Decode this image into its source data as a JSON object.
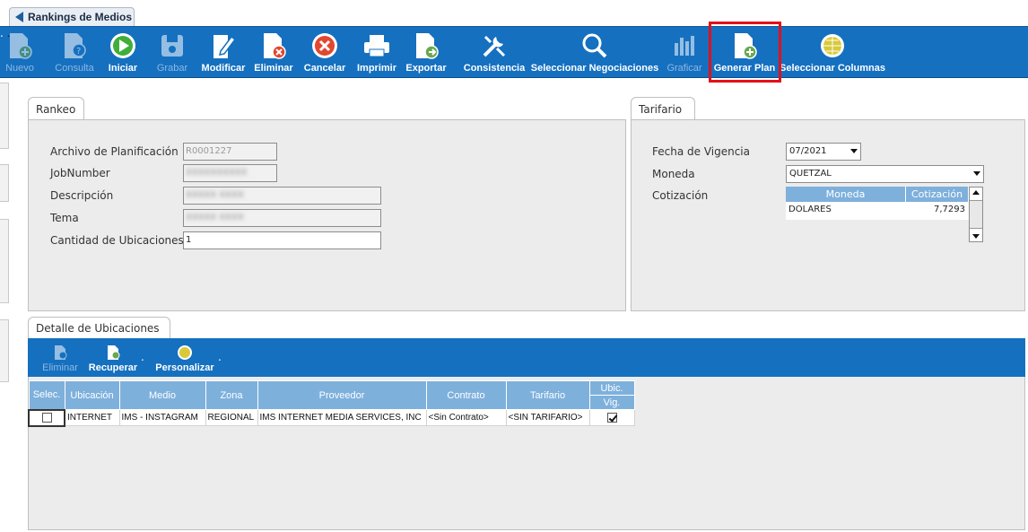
{
  "window": {
    "title": "Rankings de Medios"
  },
  "toolbar": {
    "items": [
      {
        "label": "Nuevo",
        "icon": "new-document-icon",
        "enabled": false
      },
      {
        "label": "Consulta",
        "icon": "query-document-icon",
        "enabled": false
      },
      {
        "label": "Iniciar",
        "icon": "play-icon",
        "enabled": true
      },
      {
        "label": "Grabar",
        "icon": "save-disk-icon",
        "enabled": false
      },
      {
        "label": "Modificar",
        "icon": "edit-document-icon",
        "enabled": true
      },
      {
        "label": "Eliminar",
        "icon": "delete-document-icon",
        "enabled": true
      },
      {
        "label": "Cancelar",
        "icon": "cancel-icon",
        "enabled": true
      },
      {
        "label": "Imprimir",
        "icon": "printer-icon",
        "enabled": true
      },
      {
        "label": "Exportar",
        "icon": "export-document-icon",
        "enabled": true
      },
      {
        "label": "Consistencia",
        "icon": "tools-icon",
        "enabled": true
      },
      {
        "label": "Seleccionar Negociaciones",
        "icon": "magnifier-icon",
        "enabled": true
      },
      {
        "label": "Graficar",
        "icon": "bar-chart-icon",
        "enabled": false
      },
      {
        "label": "Generar Plan",
        "icon": "generate-plan-document-icon",
        "enabled": true,
        "highlighted": true
      },
      {
        "label": "Seleccionar Columnas",
        "icon": "columns-globe-icon",
        "enabled": true
      }
    ]
  },
  "rankeo": {
    "tab_label": "Rankeo",
    "fields": {
      "archivo": {
        "label": "Archivo de Planificación",
        "value": "R0001227"
      },
      "jobnumber": {
        "label": "JobNumber",
        "value": "XXXXXXXXXX"
      },
      "descripcion": {
        "label": "Descripción",
        "value": "XXXXX XXXX"
      },
      "tema": {
        "label": "Tema",
        "value": "XXXXX XXXX"
      },
      "cantidad": {
        "label": "Cantidad de Ubicaciones",
        "value": "1"
      }
    }
  },
  "tarifario": {
    "tab_label": "Tarifario",
    "fecha_label": "Fecha de Vigencia",
    "fecha_value": "07/2021",
    "moneda_label": "Moneda",
    "moneda_value": "QUETZAL",
    "cotizacion_label": "Cotización",
    "grid": {
      "headers": [
        "Moneda",
        "Cotización"
      ],
      "rows": [
        {
          "moneda": "DOLARES",
          "cotizacion": "7,7293"
        }
      ]
    }
  },
  "detalle": {
    "tab_label": "Detalle de Ubicaciones",
    "toolbar": [
      {
        "label": "Eliminar",
        "icon": "delete-row-icon",
        "enabled": false
      },
      {
        "label": "Recuperar",
        "icon": "recover-document-icon",
        "enabled": true
      },
      {
        "label": "Personalizar",
        "icon": "customize-circle-icon",
        "enabled": true
      }
    ],
    "columns": {
      "selec": "Selec.",
      "ubicacion": "Ubicación",
      "medio": "Medio",
      "zona": "Zona",
      "proveedor": "Proveedor",
      "contrato": "Contrato",
      "tarifario": "Tarifario",
      "ubic": "Ubic.",
      "vig": "Vig."
    },
    "rows": [
      {
        "selected": false,
        "ubicacion": "INTERNET",
        "medio": "IMS - INSTAGRAM",
        "zona": "REGIONAL",
        "proveedor": "IMS INTERNET MEDIA SERVICES, INC",
        "contrato": "<Sin Contrato>",
        "tarifario": "<SIN TARIFARIO>",
        "vigente": true
      }
    ]
  },
  "colors": {
    "toolbar_blue": "#1570c0",
    "grid_header": "#7eb0dc",
    "highlight_red": "#e3101a"
  }
}
